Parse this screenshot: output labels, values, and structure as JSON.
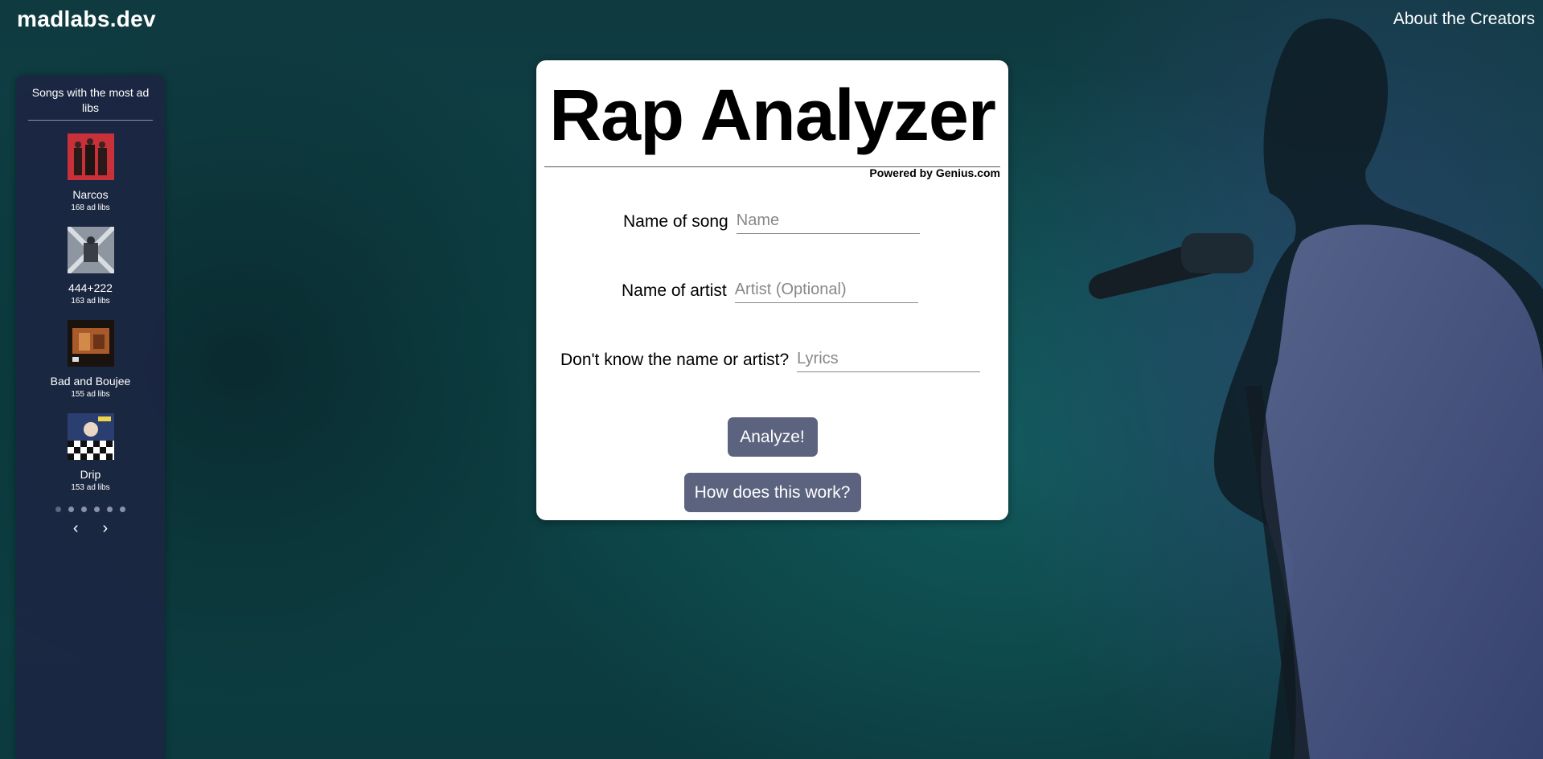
{
  "header": {
    "site_title": "madlabs.dev",
    "about_link": "About the Creators"
  },
  "sidebar": {
    "title": "Songs with the most ad libs",
    "songs": [
      {
        "title": "Narcos",
        "count": "168 ad libs",
        "cover_color": "#c8303a"
      },
      {
        "title": "444+222",
        "count": "163 ad libs",
        "cover_color": "#9aa3ad"
      },
      {
        "title": "Bad and Boujee",
        "count": "155 ad libs",
        "cover_color": "#6a3a20"
      },
      {
        "title": "Drip",
        "count": "153 ad libs",
        "cover_color": "#2a3f70"
      }
    ],
    "dots_count": 6,
    "active_dot": 0,
    "prev_icon": "‹",
    "next_icon": "›"
  },
  "card": {
    "title": "Rap Analyzer",
    "powered_by": "Powered by Genius.com",
    "song_label": "Name of song",
    "song_placeholder": "Name",
    "artist_label": "Name of artist",
    "artist_placeholder": "Artist (Optional)",
    "lyrics_label": "Don't know the name or artist?",
    "lyrics_placeholder": "Lyrics",
    "analyze_button": "Analyze!",
    "how_button": "How does this work?"
  },
  "colors": {
    "button": "#5b637e",
    "sidebar": "#1c2642"
  }
}
